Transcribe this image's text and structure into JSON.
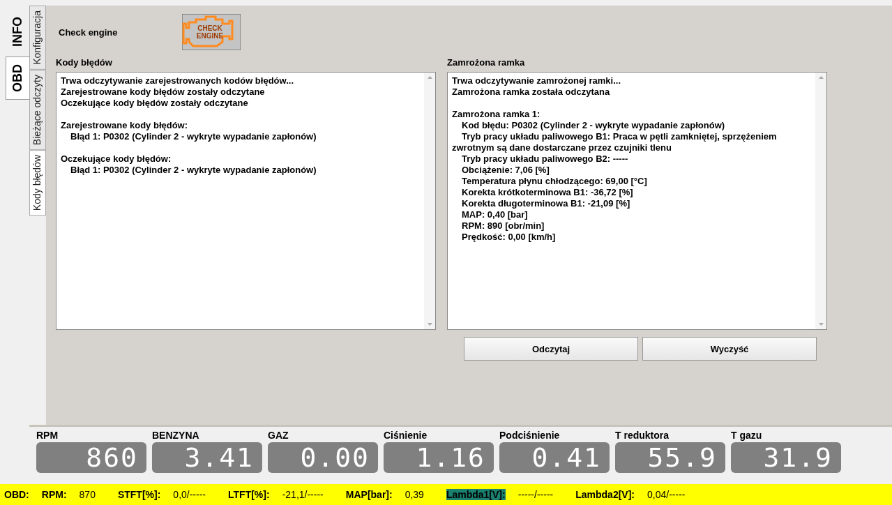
{
  "outer_tabs": [
    {
      "label": "INFO",
      "selected": false
    },
    {
      "label": "OBD",
      "selected": true
    }
  ],
  "inner_tabs": [
    {
      "label": "Konfiguracja",
      "selected": false
    },
    {
      "label": "Bieżące odczyty",
      "selected": false
    },
    {
      "label": "Kody błędów",
      "selected": true
    }
  ],
  "check_engine": {
    "label": "Check engine",
    "icon_text": [
      "CHECK",
      "ENGINE"
    ]
  },
  "error_codes": {
    "title": "Kody błędów",
    "paragraphs": [
      [
        {
          "text": "Trwa odczytywanie zarejestrowanych kodów błędów...",
          "indent": false
        },
        {
          "text": "Zarejestrowane kody błędów zostały odczytane",
          "indent": false
        },
        {
          "text": "Oczekujące kody błędów zostały odczytane",
          "indent": false
        }
      ],
      [
        {
          "text": "Zarejestrowane kody błędów:",
          "indent": false
        },
        {
          "text": "Błąd 1: P0302 (Cylinder 2 - wykryte wypadanie zapłonów)",
          "indent": true
        }
      ],
      [
        {
          "text": "Oczekujące kody błędów:",
          "indent": false
        },
        {
          "text": "Błąd 1: P0302 (Cylinder 2 - wykryte wypadanie zapłonów)",
          "indent": true
        }
      ]
    ]
  },
  "freeze_frame": {
    "title": "Zamrożona ramka",
    "paragraphs": [
      [
        {
          "text": "Trwa odczytywanie zamrożonej ramki...",
          "indent": false
        },
        {
          "text": "Zamrożona ramka została odczytana",
          "indent": false
        }
      ],
      [
        {
          "text": "Zamrożona ramka 1:",
          "indent": false
        },
        {
          "text": "Kod błędu: P0302 (Cylinder 2 - wykryte wypadanie zapłonów)",
          "indent": true
        },
        {
          "text": "Tryb pracy układu paliwowego B1: Praca w pętli zamkniętej, sprzężeniem zwrotnym są dane dostarczane przez czujniki tlenu",
          "indent": true
        },
        {
          "text": "Tryb pracy układu paliwowego B2: -----",
          "indent": true
        },
        {
          "text": "Obciążenie: 7,06 [%]",
          "indent": true
        },
        {
          "text": "Temperatura płynu chłodzącego: 69,00  [°C]",
          "indent": true
        },
        {
          "text": "Korekta krótkoterminowa B1: -36,72 [%]",
          "indent": true
        },
        {
          "text": "Korekta długoterminowa B1: -21,09 [%]",
          "indent": true
        },
        {
          "text": "MAP: 0,40  [bar]",
          "indent": true
        },
        {
          "text": "RPM: 890  [obr/min]",
          "indent": true
        },
        {
          "text": "Prędkość: 0,00  [km/h]",
          "indent": true
        }
      ]
    ]
  },
  "buttons": [
    "Odczytaj",
    "Wyczyść"
  ],
  "gauges": [
    {
      "label": "RPM",
      "value": "860"
    },
    {
      "label": "BENZYNA",
      "value": "3.41"
    },
    {
      "label": "GAZ",
      "value": "0.00"
    },
    {
      "label": "Ciśnienie",
      "value": "1.16"
    },
    {
      "label": "Podciśnienie",
      "value": "0.41"
    },
    {
      "label": "T reduktora",
      "value": "55.9"
    },
    {
      "label": "T gazu",
      "value": "31.9"
    }
  ],
  "status_bar": {
    "title": "OBD:",
    "items": [
      {
        "label": "RPM:",
        "value": "870",
        "highlighted": false
      },
      {
        "label": "STFT[%]:",
        "value": "0,0/-----",
        "highlighted": false
      },
      {
        "label": "LTFT[%]:",
        "value": "-21,1/-----",
        "highlighted": false
      },
      {
        "label": "MAP[bar]:",
        "value": "0,39",
        "highlighted": false
      },
      {
        "label": "Lambda1[V]:",
        "value": "-----/-----",
        "highlighted": true
      },
      {
        "label": "Lambda2[V]:",
        "value": "0,04/-----",
        "highlighted": false
      }
    ]
  }
}
